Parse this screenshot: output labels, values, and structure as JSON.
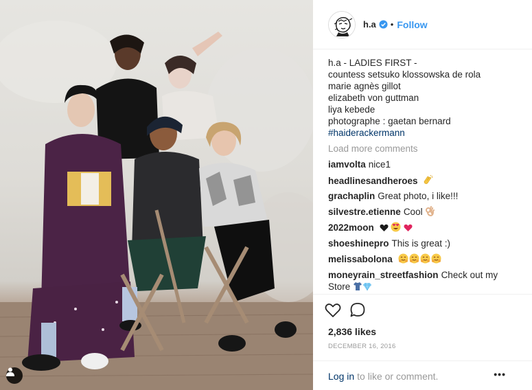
{
  "post": {
    "username": "h.a",
    "follow_label": "Follow",
    "separator": "•",
    "caption_lines": [
      "h.a - LADIES FIRST -",
      "countess setsuko klossowska de rola",
      "marie agnès gillot",
      "elizabeth von guttman",
      "liya kebede",
      "photographe : gaetan bernard"
    ],
    "hashtag": "#haiderackermann",
    "load_more": "Load more comments",
    "comments": [
      {
        "user": "iamvolta",
        "text": "nice1"
      },
      {
        "user": "headlinesandheroes",
        "text": ""
      },
      {
        "user": "grachaplin",
        "text": "Great photo, i like!!!"
      },
      {
        "user": "silvestre.etienne",
        "text": "Cool"
      },
      {
        "user": "2022moon",
        "text": ""
      },
      {
        "user": "shoeshinepro",
        "text": "This is great :)"
      },
      {
        "user": "melissabolona",
        "text": ""
      },
      {
        "user": "moneyrain_streetfashion",
        "text": "Check out my Store"
      }
    ],
    "likes": "2,836 likes",
    "date": "DECEMBER 16, 2016",
    "login_link": "Log in",
    "login_suffix": "to like or comment.",
    "more_label": "•••"
  },
  "colors": {
    "link_blue": "#3897f0",
    "hashtag_blue": "#003569",
    "muted_gray": "#999999",
    "text": "#262626"
  },
  "icons": [
    "verified-badge-icon",
    "heart-icon",
    "comment-icon",
    "user-tag-icon",
    "avatar-sketch"
  ]
}
